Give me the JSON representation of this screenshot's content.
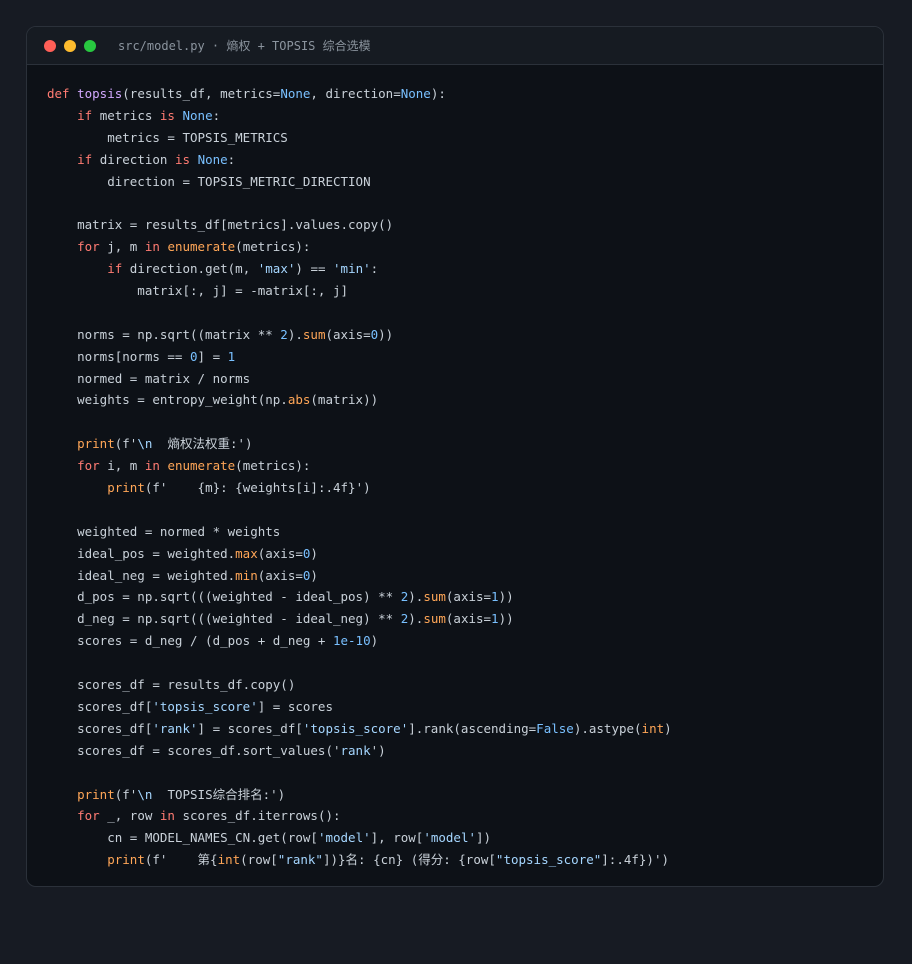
{
  "window": {
    "title": "src/model.py · 熵权 + TOPSIS 综合选模",
    "traffic_lights": [
      {
        "name": "close",
        "color": "#ff5f57"
      },
      {
        "name": "minimize",
        "color": "#febc2e"
      },
      {
        "name": "maximize",
        "color": "#28c840"
      }
    ]
  },
  "colors": {
    "background": "#171b23",
    "editor_bg": "#0d1117",
    "keyword": "#ff7b72",
    "function": "#d2a8ff",
    "number": "#79c0ff",
    "string": "#a5d6ff",
    "builtin": "#ffa657",
    "text": "#c9d1d9"
  },
  "code_lines": [
    [
      [
        "kw",
        "def "
      ],
      [
        "fn",
        "topsis"
      ],
      [
        "p",
        "(results_df, metrics="
      ],
      [
        "num",
        "None"
      ],
      [
        "p",
        ", direction="
      ],
      [
        "num",
        "None"
      ],
      [
        "p",
        "):"
      ]
    ],
    [
      [
        "p",
        "    "
      ],
      [
        "kw",
        "if"
      ],
      [
        "p",
        " metrics "
      ],
      [
        "kw",
        "is"
      ],
      [
        "p",
        " "
      ],
      [
        "num",
        "None"
      ],
      [
        "p",
        ":"
      ]
    ],
    [
      [
        "p",
        "        metrics = TOPSIS_METRICS"
      ]
    ],
    [
      [
        "p",
        "    "
      ],
      [
        "kw",
        "if"
      ],
      [
        "p",
        " direction "
      ],
      [
        "kw",
        "is"
      ],
      [
        "p",
        " "
      ],
      [
        "num",
        "None"
      ],
      [
        "p",
        ":"
      ]
    ],
    [
      [
        "p",
        "        direction = TOPSIS_METRIC_DIRECTION"
      ]
    ],
    [],
    [
      [
        "p",
        "    matrix = results_df[metrics].values.copy()"
      ]
    ],
    [
      [
        "p",
        "    "
      ],
      [
        "kw",
        "for"
      ],
      [
        "p",
        " j, m "
      ],
      [
        "kw",
        "in"
      ],
      [
        "p",
        " "
      ],
      [
        "bi",
        "enumerate"
      ],
      [
        "p",
        "(metrics):"
      ]
    ],
    [
      [
        "p",
        "        "
      ],
      [
        "kw",
        "if"
      ],
      [
        "p",
        " direction.get(m, "
      ],
      [
        "str",
        "'max'"
      ],
      [
        "p",
        ") == "
      ],
      [
        "str",
        "'min'"
      ],
      [
        "p",
        ":"
      ]
    ],
    [
      [
        "p",
        "            matrix[:, j] = -matrix[:, j]"
      ]
    ],
    [],
    [
      [
        "p",
        "    norms = np.sqrt((matrix ** "
      ],
      [
        "num",
        "2"
      ],
      [
        "p",
        ")."
      ],
      [
        "bi",
        "sum"
      ],
      [
        "p",
        "(axis="
      ],
      [
        "num",
        "0"
      ],
      [
        "p",
        "))"
      ]
    ],
    [
      [
        "p",
        "    norms[norms == "
      ],
      [
        "num",
        "0"
      ],
      [
        "p",
        "] = "
      ],
      [
        "num",
        "1"
      ]
    ],
    [
      [
        "p",
        "    normed = matrix / norms"
      ]
    ],
    [
      [
        "p",
        "    weights = entropy_weight(np."
      ],
      [
        "bi",
        "abs"
      ],
      [
        "p",
        "(matrix))"
      ]
    ],
    [],
    [
      [
        "p",
        "    "
      ],
      [
        "bi",
        "print"
      ],
      [
        "p",
        "(f'"
      ],
      [
        "str",
        "\\n"
      ],
      [
        "p",
        "  熵权法权重:')"
      ]
    ],
    [
      [
        "p",
        "    "
      ],
      [
        "kw",
        "for"
      ],
      [
        "p",
        " i, m "
      ],
      [
        "kw",
        "in"
      ],
      [
        "p",
        " "
      ],
      [
        "bi",
        "enumerate"
      ],
      [
        "p",
        "(metrics):"
      ]
    ],
    [
      [
        "p",
        "        "
      ],
      [
        "bi",
        "print"
      ],
      [
        "p",
        "(f'    {m}: {weights[i]:.4f}')"
      ]
    ],
    [],
    [
      [
        "p",
        "    weighted = normed * weights"
      ]
    ],
    [
      [
        "p",
        "    ideal_pos = weighted."
      ],
      [
        "bi",
        "max"
      ],
      [
        "p",
        "(axis="
      ],
      [
        "num",
        "0"
      ],
      [
        "p",
        ")"
      ]
    ],
    [
      [
        "p",
        "    ideal_neg = weighted."
      ],
      [
        "bi",
        "min"
      ],
      [
        "p",
        "(axis="
      ],
      [
        "num",
        "0"
      ],
      [
        "p",
        ")"
      ]
    ],
    [
      [
        "p",
        "    d_pos = np.sqrt(((weighted - ideal_pos) ** "
      ],
      [
        "num",
        "2"
      ],
      [
        "p",
        ")."
      ],
      [
        "bi",
        "sum"
      ],
      [
        "p",
        "(axis="
      ],
      [
        "num",
        "1"
      ],
      [
        "p",
        "))"
      ]
    ],
    [
      [
        "p",
        "    d_neg = np.sqrt(((weighted - ideal_neg) ** "
      ],
      [
        "num",
        "2"
      ],
      [
        "p",
        ")."
      ],
      [
        "bi",
        "sum"
      ],
      [
        "p",
        "(axis="
      ],
      [
        "num",
        "1"
      ],
      [
        "p",
        "))"
      ]
    ],
    [
      [
        "p",
        "    scores = d_neg / (d_pos + d_neg + "
      ],
      [
        "num",
        "1e-10"
      ],
      [
        "p",
        ")"
      ]
    ],
    [],
    [
      [
        "p",
        "    scores_df = results_df.copy()"
      ]
    ],
    [
      [
        "p",
        "    scores_df["
      ],
      [
        "str",
        "'topsis_score'"
      ],
      [
        "p",
        "] = scores"
      ]
    ],
    [
      [
        "p",
        "    scores_df["
      ],
      [
        "str",
        "'rank'"
      ],
      [
        "p",
        "] = scores_df["
      ],
      [
        "str",
        "'topsis_score'"
      ],
      [
        "p",
        "].rank(ascending="
      ],
      [
        "num",
        "False"
      ],
      [
        "p",
        ").astype("
      ],
      [
        "bi",
        "int"
      ],
      [
        "p",
        ")"
      ]
    ],
    [
      [
        "p",
        "    scores_df = scores_df.sort_values('"
      ],
      [
        "str",
        "rank"
      ],
      [
        "p",
        "')"
      ]
    ],
    [],
    [
      [
        "p",
        "    "
      ],
      [
        "bi",
        "print"
      ],
      [
        "p",
        "(f'"
      ],
      [
        "str",
        "\\n"
      ],
      [
        "p",
        "  TOPSIS综合排名:')"
      ]
    ],
    [
      [
        "p",
        "    "
      ],
      [
        "kw",
        "for"
      ],
      [
        "p",
        " _, row "
      ],
      [
        "kw",
        "in"
      ],
      [
        "p",
        " scores_df.iterrows():"
      ]
    ],
    [
      [
        "p",
        "        cn = MODEL_NAMES_CN.get(row["
      ],
      [
        "str",
        "'model'"
      ],
      [
        "p",
        "], row["
      ],
      [
        "str",
        "'model'"
      ],
      [
        "p",
        "])"
      ]
    ],
    [
      [
        "p",
        "        "
      ],
      [
        "bi",
        "print"
      ],
      [
        "p",
        "(f'    第{"
      ],
      [
        "bi",
        "int"
      ],
      [
        "p",
        "(row["
      ],
      [
        "str",
        "\"rank\""
      ],
      [
        "p",
        "])}名: {cn} (得分: {row["
      ],
      [
        "str",
        "\"topsis_score\""
      ],
      [
        "p",
        "]:.4f})')"
      ]
    ]
  ]
}
